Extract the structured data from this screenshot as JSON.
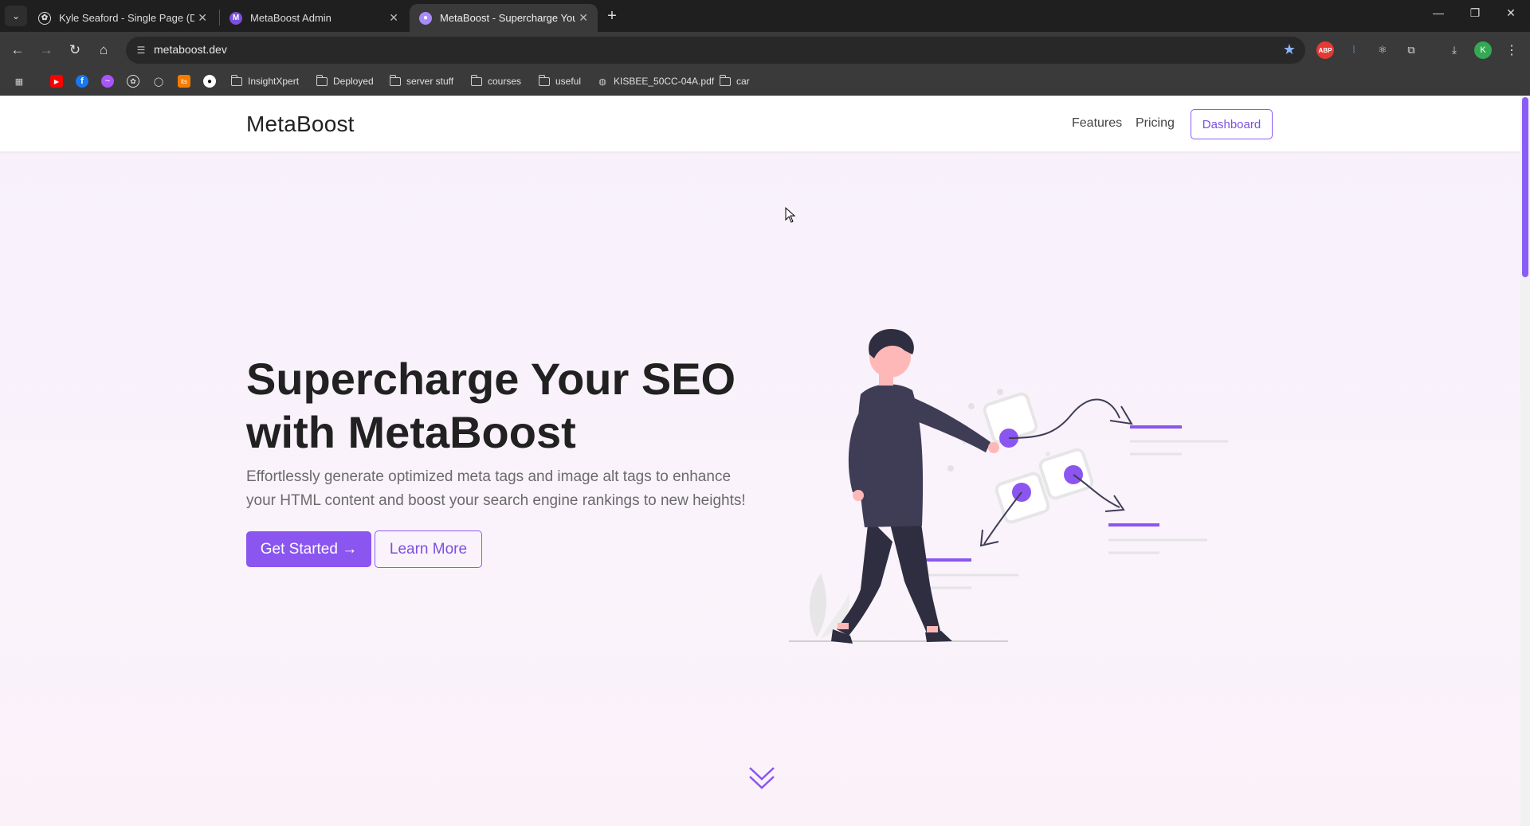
{
  "browser": {
    "tabs": [
      {
        "title": "Kyle Seaford - Single Page (Dar",
        "active": false
      },
      {
        "title": "MetaBoost Admin",
        "active": false
      },
      {
        "title": "MetaBoost - Supercharge Your",
        "active": true
      }
    ],
    "url": "metaboost.dev",
    "bookmarks": [
      "InsightXpert",
      "Deployed",
      "server stuff",
      "courses",
      "useful",
      "KISBEE_50CC-04A.pdf",
      "car"
    ],
    "profile_initial": "K"
  },
  "site": {
    "brand": "MetaBoost",
    "nav": {
      "features": "Features",
      "pricing": "Pricing",
      "dashboard": "Dashboard"
    },
    "hero": {
      "title": "Supercharge Your SEO with MetaBoost",
      "subtitle": "Effortlessly generate optimized meta tags and image alt tags to enhance your HTML content and boost your search engine rankings to new heights!",
      "primary_button": "Get Started →",
      "secondary_button": "Learn More"
    },
    "colors": {
      "accent": "#8b55f0",
      "text": "#212121",
      "muted": "#6a6a6a"
    }
  }
}
